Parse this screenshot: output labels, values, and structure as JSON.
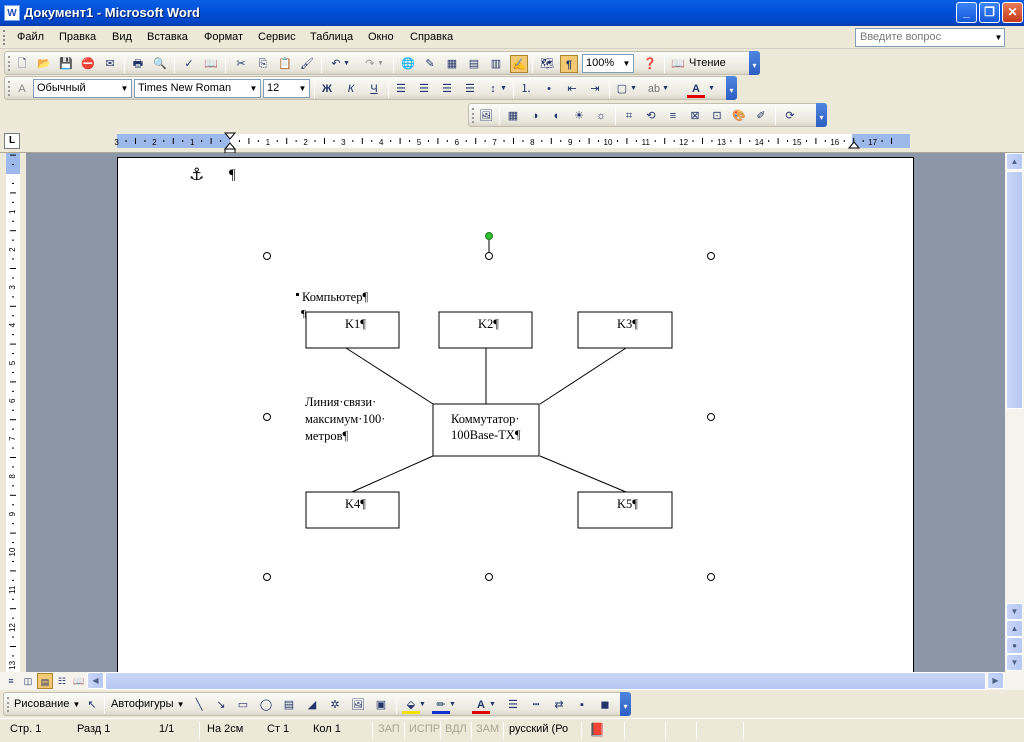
{
  "window": {
    "title": "Документ1 - Microsoft Word",
    "app_icon": "word-doc-icon"
  },
  "menu": {
    "items": [
      "Файл",
      "Правка",
      "Вид",
      "Вставка",
      "Формат",
      "Сервис",
      "Таблица",
      "Окно",
      "Справка"
    ],
    "help_placeholder": "Введите вопрос"
  },
  "standard_toolbar": {
    "zoom": "100%",
    "reading_label": "Чтение"
  },
  "formatting_toolbar": {
    "style": "Обычный",
    "font": "Times New Roman",
    "size": "12"
  },
  "ruler": {
    "h_labels": [
      "3",
      "2",
      "1",
      "1",
      "2",
      "3",
      "4",
      "5",
      "6",
      "7",
      "8",
      "9",
      "10",
      "11",
      "12",
      "13",
      "14",
      "15",
      "16",
      "17"
    ],
    "v_labels": [
      "1",
      "1",
      "2",
      "3",
      "4",
      "5",
      "6",
      "7",
      "8",
      "9",
      "10",
      "11",
      "12",
      "13"
    ]
  },
  "document": {
    "anchor_mark": "⚓",
    "para_mark": "¶",
    "caption": "Компьютер¶",
    "para_mark2": "¶",
    "link_label_lines": [
      "Линия·связи·",
      "максимум·100·",
      "метров¶"
    ],
    "switch_lines": [
      "Коммутатор·",
      "100Base-TX¶"
    ],
    "nodes": [
      "K1¶",
      "K2¶",
      "K3¶",
      "K4¶",
      "K5¶"
    ]
  },
  "drawing_toolbar": {
    "drawing_label": "Рисование",
    "autoshapes_label": "Автофигуры"
  },
  "status": {
    "page": "Стр.  1",
    "section": "Разд  1",
    "pages": "1/1",
    "at": "На  2см",
    "line": "Ст  1",
    "col": "Кол  1",
    "rec": "ЗАП",
    "trk": "ИСПР",
    "ext": "ВДЛ",
    "ovr": "ЗАМ",
    "lang": "русский (Ро"
  },
  "colors": {
    "titlebar": "#0050d8",
    "doc_background": "#8d96a6",
    "rotate_handle": "#2fbf2f"
  }
}
